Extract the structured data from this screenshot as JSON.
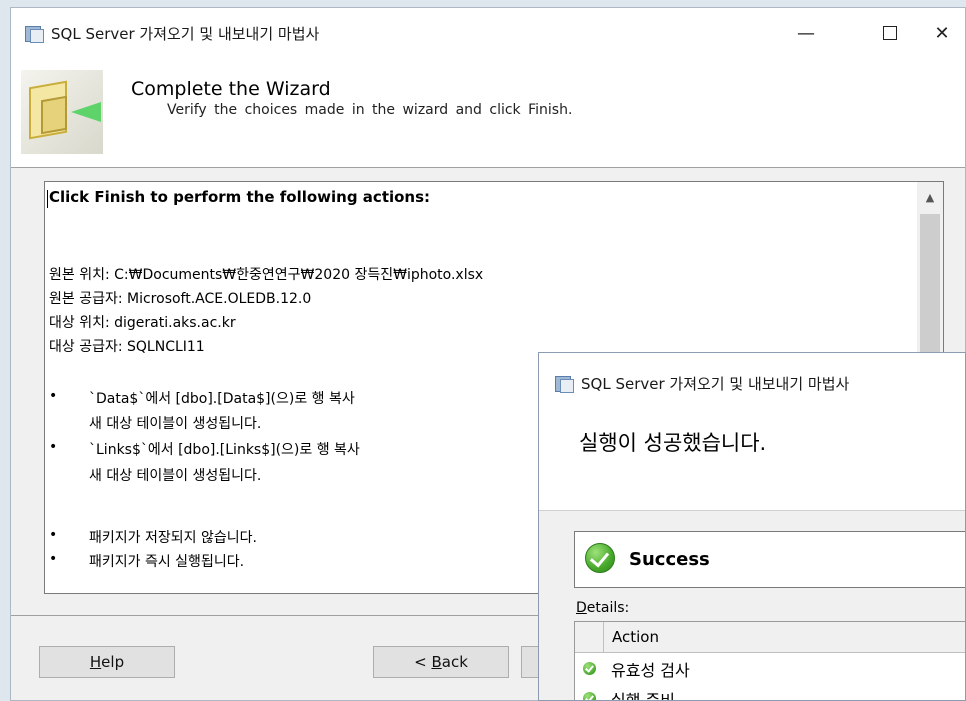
{
  "main_window": {
    "title": "SQL Server 가져오기 및 내보내기 마법사",
    "controls": {
      "minimize": "—",
      "close": "✕"
    },
    "header": {
      "title": "Complete the Wizard",
      "subtitle": "Verify the choices made in the wizard and click Finish."
    },
    "summary": {
      "heading": "Click Finish to perform the following actions:",
      "details": [
        "원본 위치: C:₩Documents₩한중연연구₩2020 장득진₩iphoto.xlsx",
        "원본 공급자: Microsoft.ACE.OLEDB.12.0",
        "대상 위치: digerati.aks.ac.kr",
        "대상 공급자: SQLNCLI11"
      ],
      "actions": [
        {
          "text": "`Data$`에서 [dbo].[Data$](으)로 행 복사",
          "note": "새 대상 테이블이 생성됩니다."
        },
        {
          "text": "`Links$`에서 [dbo].[Links$](으)로 행 복사",
          "note": "새 대상 테이블이 생성됩니다."
        }
      ],
      "package_notes": [
        "패키지가 저장되지 않습니다.",
        "패키지가 즉시 실행됩니다."
      ],
      "bullet": "•",
      "scroll_up": "▲"
    },
    "buttons": {
      "help": {
        "underline": "H",
        "rest": "elp"
      },
      "back": {
        "prefix": "< ",
        "underline": "B",
        "rest": "ack"
      }
    }
  },
  "progress_window": {
    "title": "SQL Server 가져오기 및 내보내기 마법사",
    "heading": "실행이 성공했습니다.",
    "status": "Success",
    "details_label": {
      "underline": "D",
      "rest": "etails:"
    },
    "grid": {
      "column": "Action",
      "rows": [
        {
          "action": "유효성 검사",
          "status": "success"
        },
        {
          "action": "실행 준비",
          "status": "success"
        }
      ]
    }
  },
  "colors": {
    "success": "#46a82a",
    "window_bg": "#f0f0f0",
    "desktop": "#dfe7ee"
  },
  "icons": [
    "app-icon",
    "wizard-image",
    "success-icon",
    "check-icon",
    "chevron-up-icon"
  ]
}
